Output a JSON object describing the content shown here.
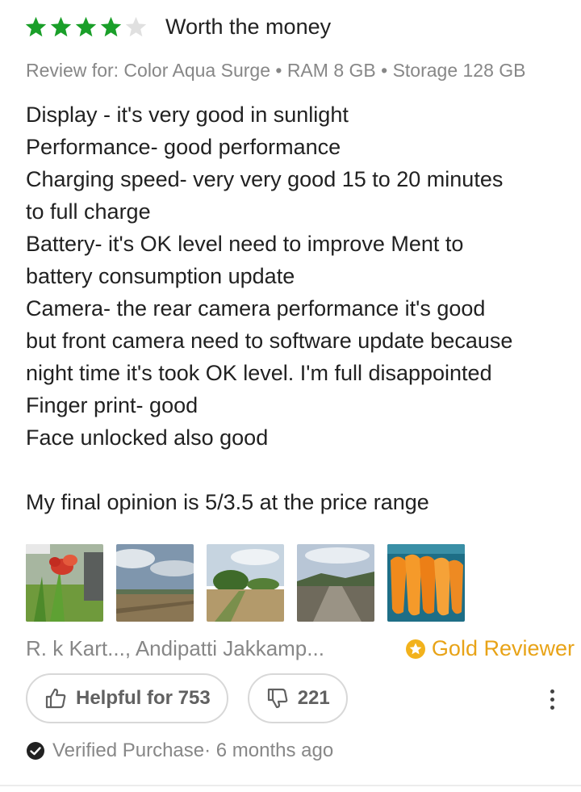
{
  "review": {
    "rating": 4,
    "rating_max": 5,
    "title": "Worth the money",
    "variant": "Review for: Color Aqua Surge • RAM 8 GB • Storage 128 GB",
    "body_lines": [
      "Display - it's very good in sunlight",
      "Performance- good performance",
      "Charging speed- very very good  15 to 20 minutes",
      "to full charge",
      "Battery- it's OK level need to improve Ment to",
      "battery consumption update",
      "Camera- the rear camera performance it's good",
      "but front camera need to software update because",
      "night time it's took OK level. I'm full disappointed",
      "Finger print- good",
      "Face unlocked also good",
      "",
      "My final opinion is 5/3.5 at the price range"
    ],
    "photos": [
      {
        "icon": "flower-plant-photo"
      },
      {
        "icon": "field-sky-photo"
      },
      {
        "icon": "farm-tree-photo"
      },
      {
        "icon": "road-hills-photo"
      },
      {
        "icon": "fried-snack-photo"
      }
    ],
    "reviewer": {
      "name": "R. k Kart...",
      "location": ", Andipatti Jakkamp...",
      "badge": "Gold Reviewer"
    },
    "helpful_label": "Helpful for 753",
    "dislike_count": "221",
    "verified_label": "Verified Purchase· 6 months ago"
  },
  "colors": {
    "star_filled": "#1a9f29",
    "star_empty": "#e0e0e0",
    "gold": "#e8a317",
    "muted_text": "#878787"
  }
}
